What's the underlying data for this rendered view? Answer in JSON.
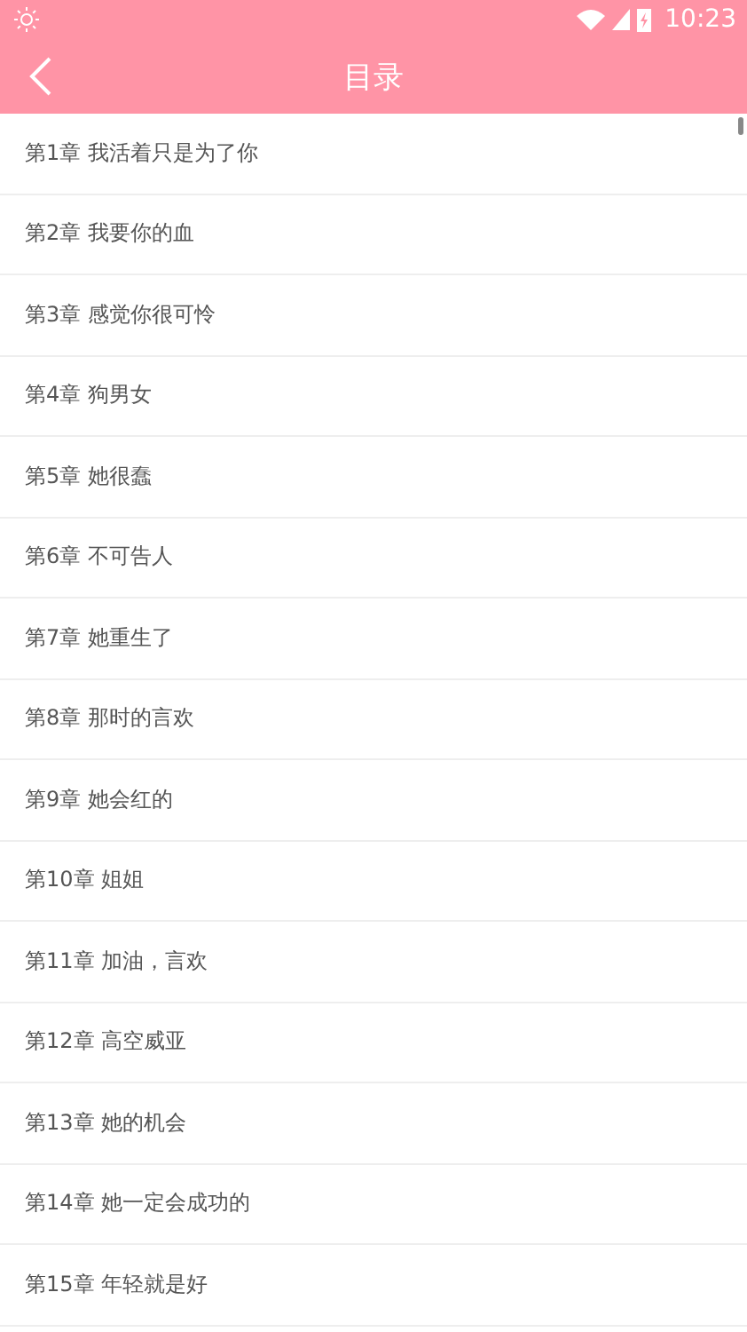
{
  "status_bar": {
    "time": "10:23"
  },
  "toolbar": {
    "title": "目录"
  },
  "chapters": [
    {
      "label": "第1章 我活着只是为了你"
    },
    {
      "label": "第2章 我要你的血"
    },
    {
      "label": "第3章 感觉你很可怜"
    },
    {
      "label": "第4章 狗男女"
    },
    {
      "label": "第5章 她很蠢"
    },
    {
      "label": "第6章 不可告人"
    },
    {
      "label": "第7章 她重生了"
    },
    {
      "label": "第8章 那时的言欢"
    },
    {
      "label": "第9章 她会红的"
    },
    {
      "label": "第10章 姐姐"
    },
    {
      "label": "第11章 加油，言欢"
    },
    {
      "label": "第12章 高空威亚"
    },
    {
      "label": "第13章 她的机会"
    },
    {
      "label": "第14章 她一定会成功的"
    },
    {
      "label": "第15章 年轻就是好"
    }
  ]
}
